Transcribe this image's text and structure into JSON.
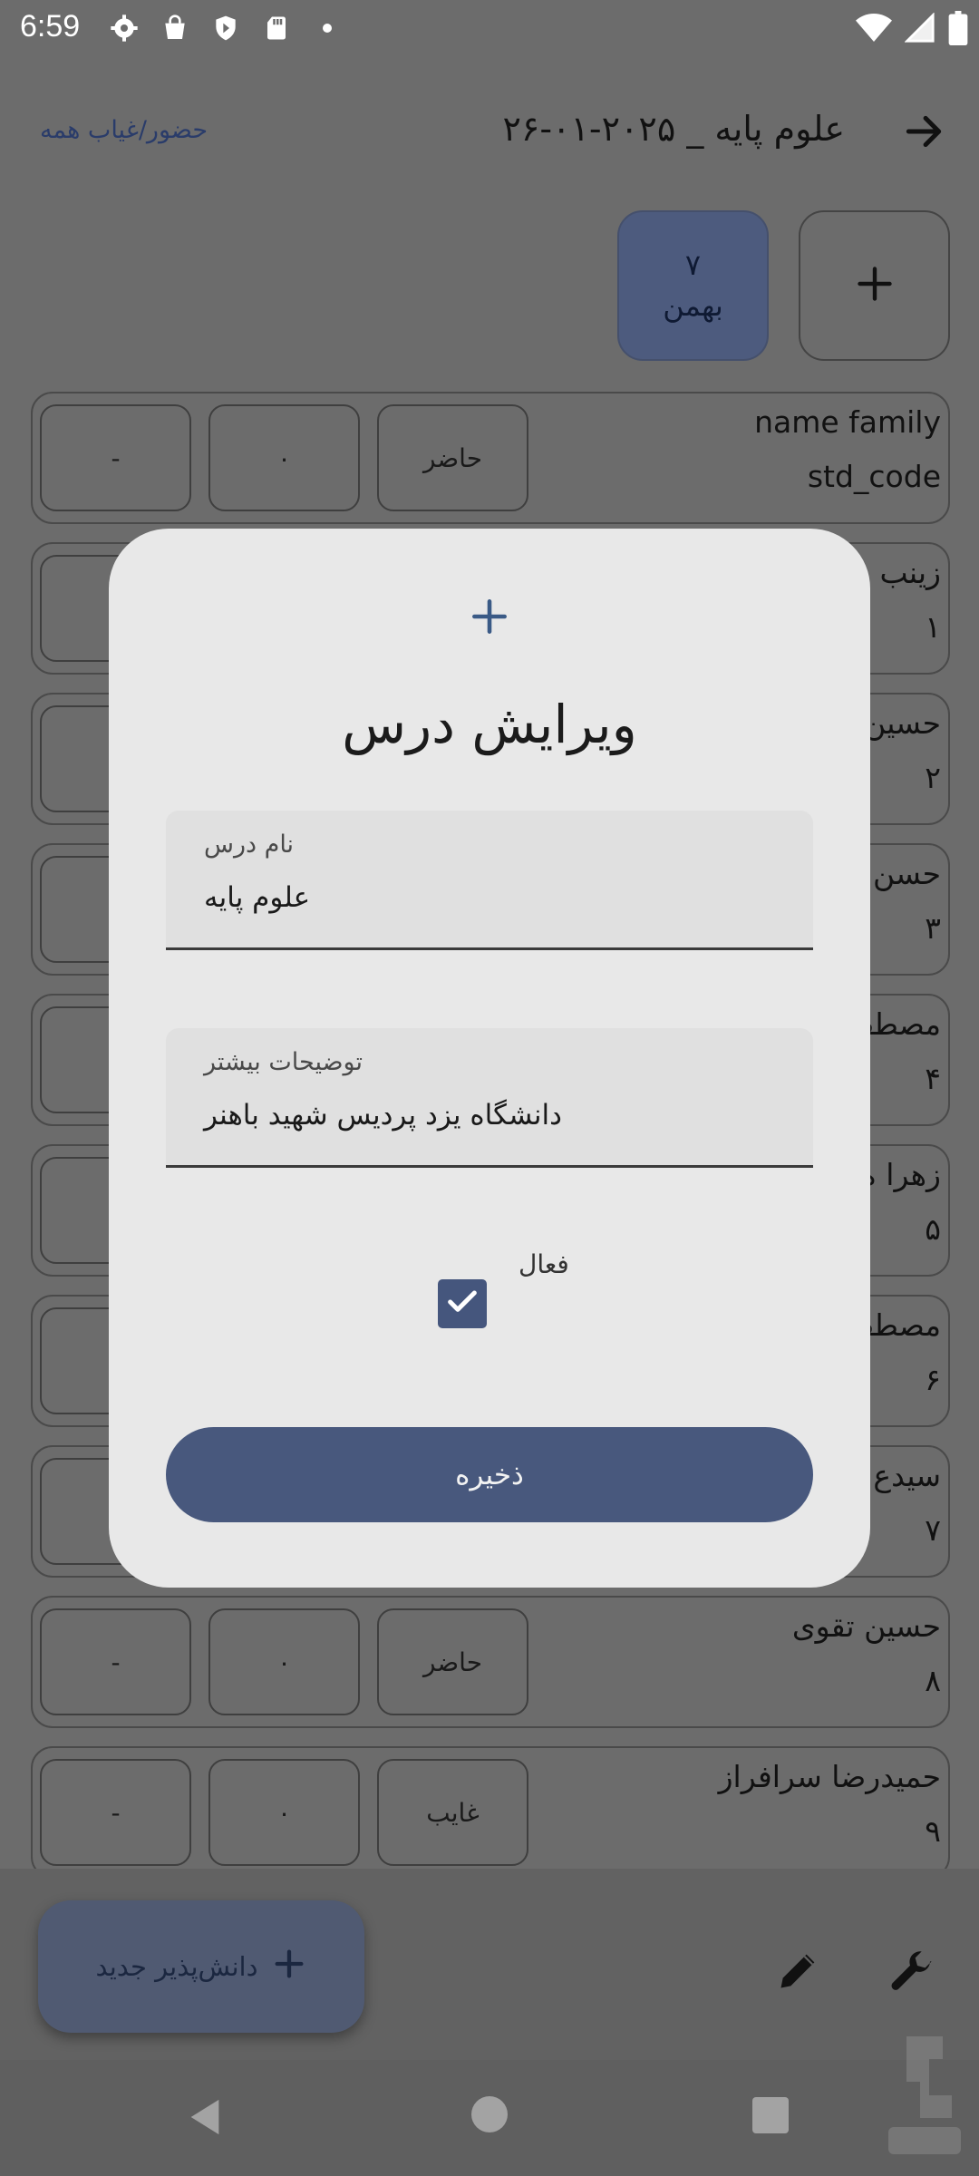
{
  "status_bar": {
    "time": "6:59",
    "icons": [
      "gear-icon",
      "shopping-bag-icon",
      "shield-icon",
      "sd-card-icon",
      "dot-icon",
      "wifi-icon",
      "signal-icon",
      "battery-icon"
    ]
  },
  "app_bar": {
    "title": "علوم پایه _ ۲۰۲۵-۰۱-۲۶",
    "attendance_all_link": "حضور/غیاب همه",
    "back_icon": "arrow-right-icon"
  },
  "date_chips": {
    "add_icon": "plus-icon",
    "selected_day": "۷",
    "selected_month": "بهمن"
  },
  "students": [
    {
      "name": "name family",
      "code": "std_code",
      "status": "حاضر",
      "score": "۰",
      "note": "-"
    },
    {
      "name": "زینب",
      "code": "۱",
      "status": "",
      "score": "",
      "note": ""
    },
    {
      "name": "حسین",
      "code": "۲",
      "status": "",
      "score": "",
      "note": ""
    },
    {
      "name": "حسن",
      "code": "۳",
      "status": "",
      "score": "",
      "note": ""
    },
    {
      "name": "مصطف",
      "code": "۴",
      "status": "",
      "score": "",
      "note": ""
    },
    {
      "name": "زهرا ه",
      "code": "۵",
      "status": "",
      "score": "",
      "note": ""
    },
    {
      "name": "مصطف",
      "code": "۶",
      "status": "",
      "score": "",
      "note": ""
    },
    {
      "name": "سیدع",
      "code": "۷",
      "status": "",
      "score": "",
      "note": ""
    },
    {
      "name": "حسین تقوی",
      "code": "۸",
      "status": "حاضر",
      "score": "۰",
      "note": "-"
    },
    {
      "name": "حمیدرضا سرافراز",
      "code": "۹",
      "status": "غایب",
      "score": "۰",
      "note": "-"
    }
  ],
  "bottom_bar": {
    "fab_label": "دانش‌پذیر جدید",
    "fab_icon": "plus-icon",
    "edit_icon": "pencil-icon",
    "settings_icon": "wrench-icon"
  },
  "dialog": {
    "icon": "plus-icon",
    "title": "ویرایش درس",
    "course_name_label": "نام درس",
    "course_name_value": "علوم پایه",
    "description_label": "توضیحات بیشتر",
    "description_value": "دانشگاه یزد پردیس شهید باهنر",
    "active_label": "فعال",
    "active_checked": true,
    "save_label": "ذخیره"
  },
  "nav_bar": {
    "icons": [
      "nav-back-icon",
      "nav-home-icon",
      "nav-recents-icon"
    ]
  },
  "colors": {
    "accent": "#48587d",
    "dialog_bg": "#e8e8e8",
    "scrim": "#6c6c6c"
  }
}
